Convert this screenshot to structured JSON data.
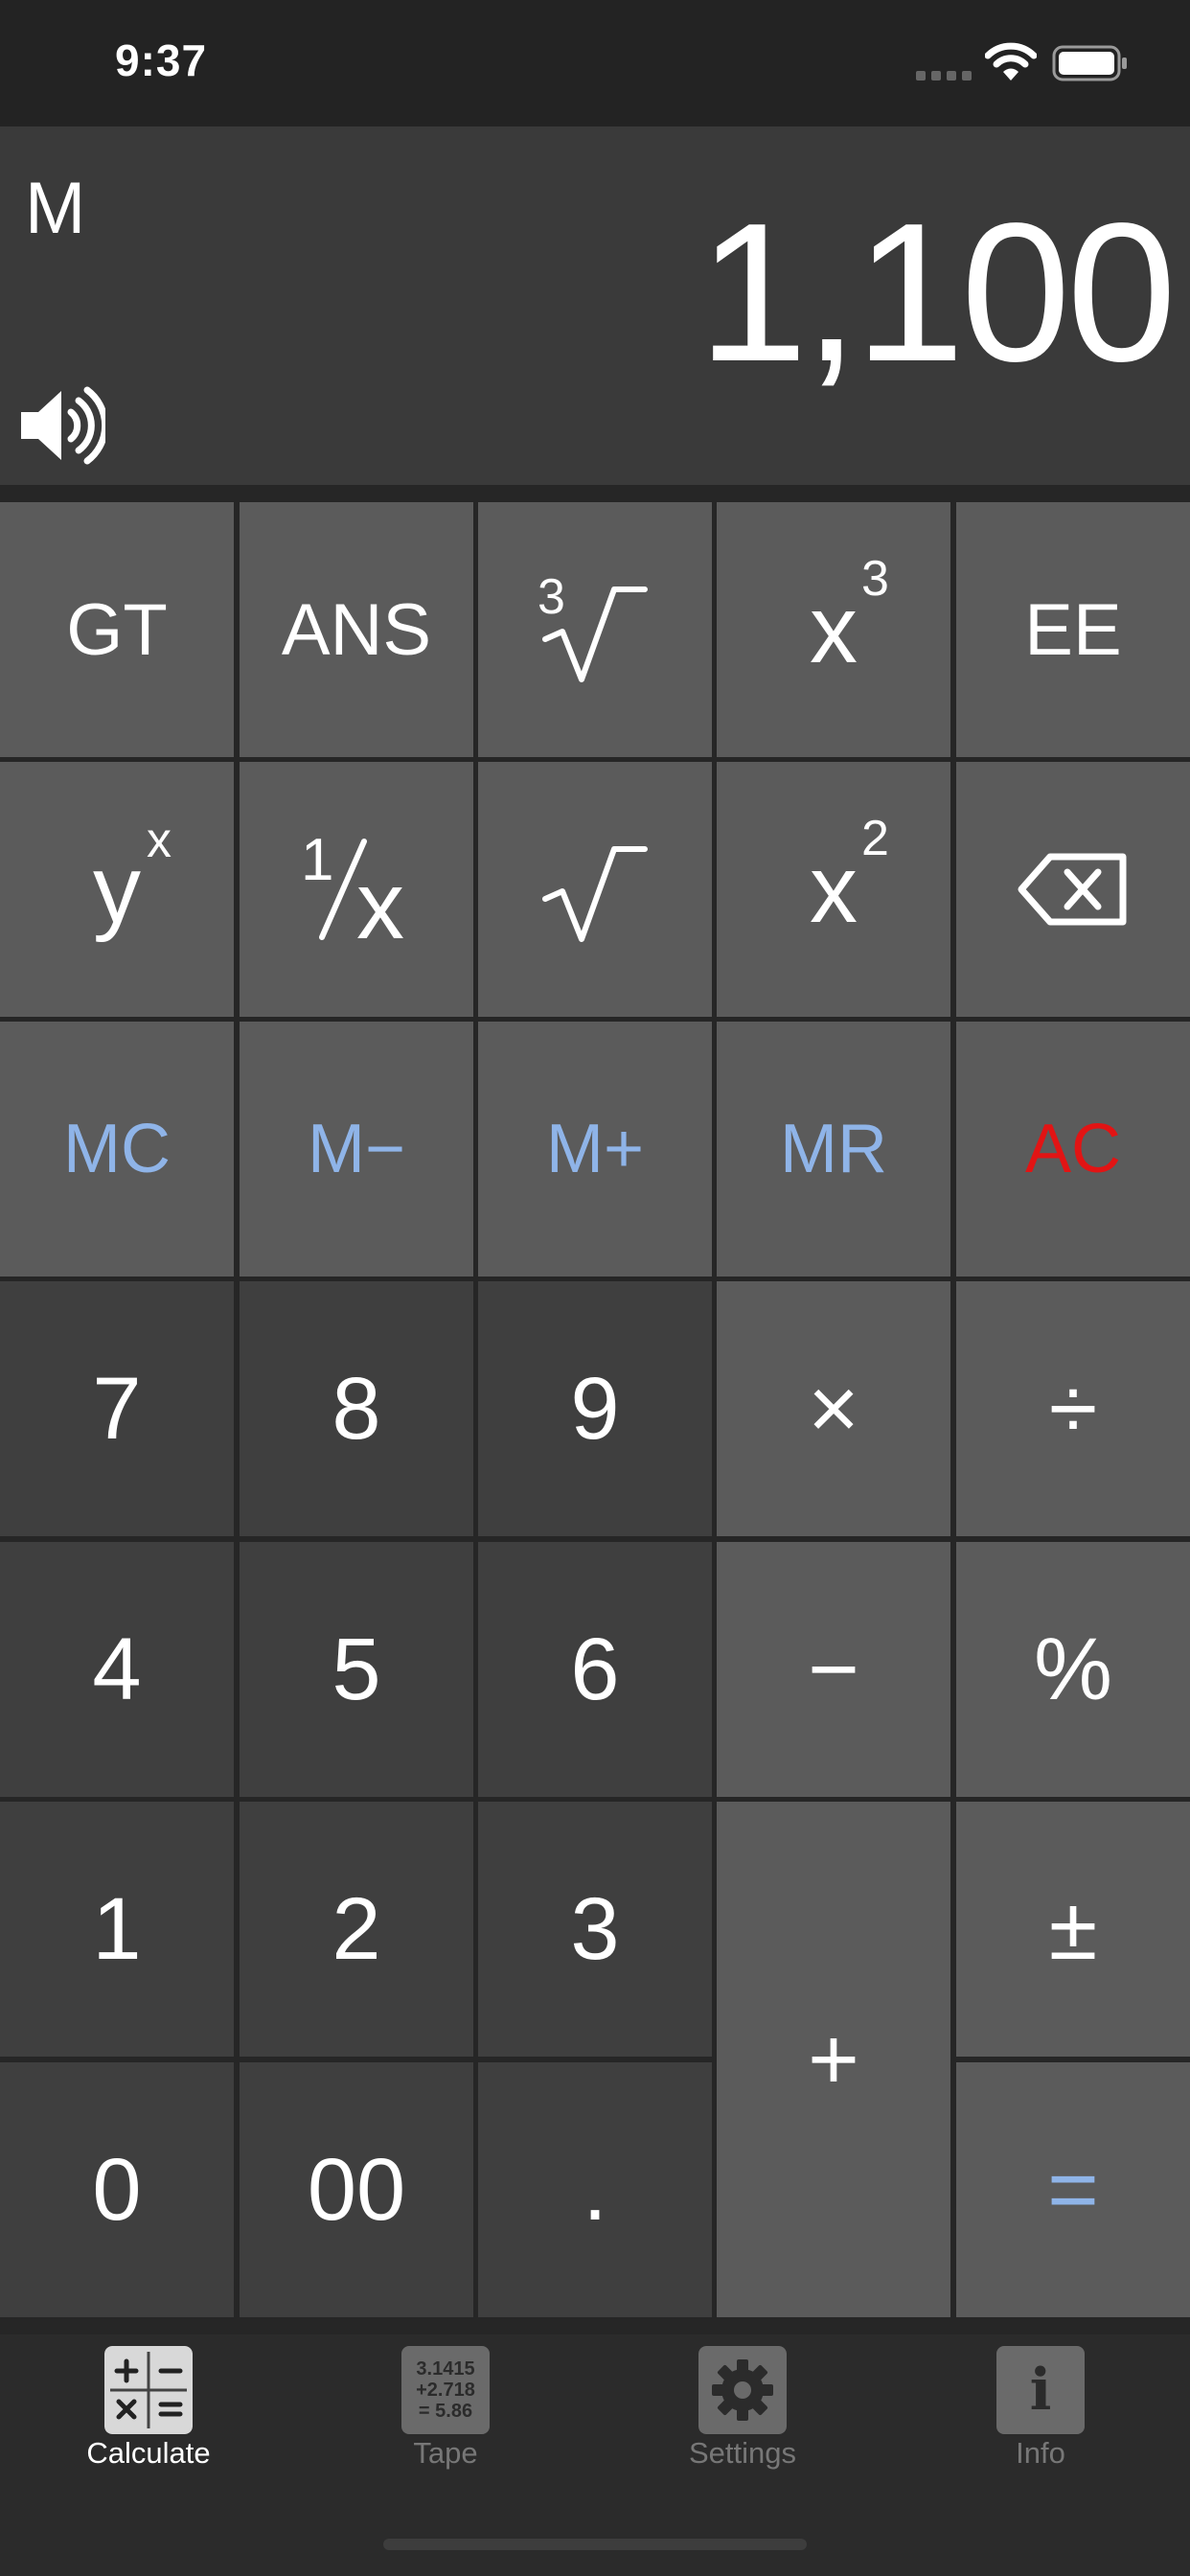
{
  "status_bar": {
    "time": "9:37"
  },
  "display": {
    "memory_indicator": "M",
    "value": "1,100"
  },
  "keypad": {
    "gt": "GT",
    "ans": "ANS",
    "cube_root_index": "3",
    "root_symbol": "√",
    "cube_base": "x",
    "cube_exp": "3",
    "ee": "EE",
    "power_base": "y",
    "power_exp": "x",
    "reciprocal_num": "1",
    "reciprocal_den": "x",
    "square_base": "x",
    "square_exp": "2",
    "mc": "MC",
    "m_minus": "M−",
    "m_plus": "M+",
    "mr": "MR",
    "ac": "AC",
    "seven": "7",
    "eight": "8",
    "nine": "9",
    "multiply": "×",
    "divide": "÷",
    "four": "4",
    "five": "5",
    "six": "6",
    "minus": "−",
    "percent": "%",
    "one": "1",
    "two": "2",
    "three": "3",
    "plus": "+",
    "plus_minus": "±",
    "zero": "0",
    "double_zero": "00",
    "decimal": ".",
    "equals": "="
  },
  "tabbar": {
    "calculate": "Calculate",
    "tape": "Tape",
    "tape_icon_lines": [
      "3.1415",
      "+2.718",
      "= 5.86"
    ],
    "settings": "Settings",
    "info": "Info",
    "info_icon_glyph": "i"
  },
  "colors": {
    "memory_blue": "#8fb4e8",
    "clear_red": "#e21414",
    "number_key": "#3f3f3f",
    "function_key": "#5b5b5b"
  },
  "icons": [
    "wifi-icon",
    "battery-icon",
    "signal-icon",
    "speaker-icon",
    "backspace-icon",
    "gear-icon",
    "info-icon",
    "calculate-icon",
    "tape-icon"
  ]
}
